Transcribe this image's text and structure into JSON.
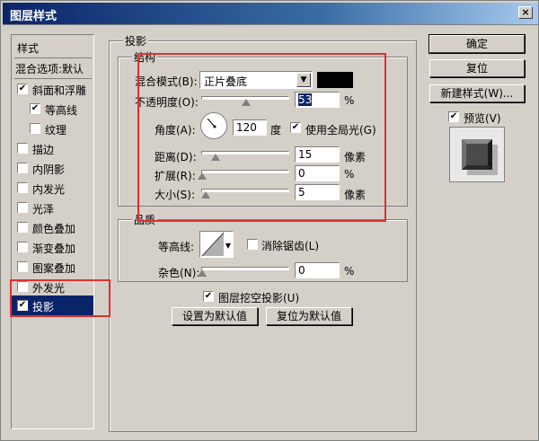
{
  "window": {
    "title": "图层样式",
    "close_glyph": "×"
  },
  "left_panel": {
    "items": [
      {
        "label": "样式",
        "checkbox": false
      },
      {
        "label": "混合选项:默认",
        "checkbox": false
      },
      {
        "label": "斜面和浮雕",
        "checkbox": true,
        "checked": true
      },
      {
        "label": "等高线",
        "checkbox": true,
        "checked": true,
        "indent": true
      },
      {
        "label": "纹理",
        "checkbox": true,
        "checked": false,
        "indent": true
      },
      {
        "label": "描边",
        "checkbox": true,
        "checked": false
      },
      {
        "label": "内阴影",
        "checkbox": true,
        "checked": false
      },
      {
        "label": "内发光",
        "checkbox": true,
        "checked": false
      },
      {
        "label": "光泽",
        "checkbox": true,
        "checked": false
      },
      {
        "label": "颜色叠加",
        "checkbox": true,
        "checked": false
      },
      {
        "label": "渐变叠加",
        "checkbox": true,
        "checked": false
      },
      {
        "label": "图案叠加",
        "checkbox": true,
        "checked": false
      },
      {
        "label": "外发光",
        "checkbox": true,
        "checked": false
      },
      {
        "label": "投影",
        "checkbox": true,
        "checked": true,
        "selected": true
      }
    ]
  },
  "shadow": {
    "group_title": "投影",
    "structure": {
      "title": "结构",
      "blend_mode_label": "混合模式(B):",
      "blend_mode_value": "正片叠底",
      "shadow_color": "#000000",
      "opacity_label": "不透明度(O):",
      "opacity_value": "53",
      "opacity_unit": "%",
      "angle_label": "角度(A):",
      "angle_value": "120",
      "angle_unit": "度",
      "global_light_label": "使用全局光(G)",
      "global_light_checked": true,
      "distance_label": "距离(D):",
      "distance_value": "15",
      "distance_unit": "像素",
      "spread_label": "扩展(R):",
      "spread_value": "0",
      "spread_unit": "%",
      "size_label": "大小(S):",
      "size_value": "5",
      "size_unit": "像素"
    },
    "quality": {
      "title": "品质",
      "contour_label": "等高线:",
      "antialias_label": "消除锯齿(L)",
      "antialias_checked": false,
      "noise_label": "杂色(N):",
      "noise_value": "0",
      "noise_unit": "%"
    },
    "knockout_label": "图层挖空投影(U)",
    "knockout_checked": true,
    "set_default_label": "设置为默认值",
    "reset_default_label": "复位为默认值"
  },
  "right_buttons": {
    "ok": "确定",
    "reset": "复位",
    "new_style": "新建样式(W)...",
    "preview_label": "预览(V)",
    "preview_checked": true
  },
  "check_glyph": "✔",
  "arrow_glyph": "▼",
  "highlight_color": "#e03030"
}
